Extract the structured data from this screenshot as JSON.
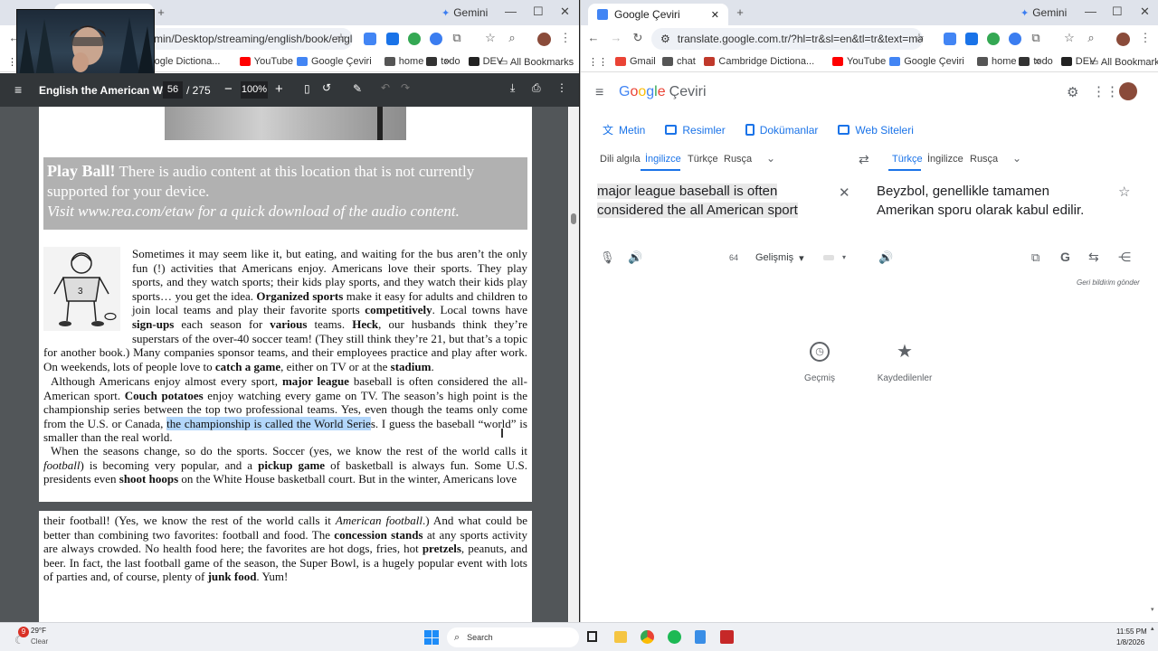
{
  "left_window": {
    "tab_title": "English the American Way",
    "gemini_label": "Gemini",
    "url": "min/Desktop/streaming/english/book/engli...",
    "bookmarks": [
      {
        "label": "Google Dictiona...",
        "color": "#4285f4"
      },
      {
        "label": "YouTube",
        "color": "#ff0000"
      },
      {
        "label": "Google Çeviri",
        "color": "#4285f4"
      },
      {
        "label": "home",
        "color": "#555555"
      },
      {
        "label": "todo",
        "color": "#333333"
      },
      {
        "label": "DEV",
        "color": "#222222"
      }
    ],
    "all_bookmarks": "All Bookmarks",
    "pdf": {
      "title": "English the American Way",
      "page_current": "56",
      "page_total": "/ 275",
      "zoom": "100%",
      "audio_bold": "Play Ball!",
      "audio_text": " There is audio content at this location that is not currently supported for your device.",
      "audio_link": "Visit www.rea.com/etaw for a quick download of the audio content.",
      "para1": [
        {
          "t": "Sometimes it may seem like it, but eating, and waiting for the bus aren’t the only fun (!) activities that Americans enjoy. Americans love their sports. They play sports, and they watch sports; their kids play sports, and they watch their kids play sports… you get the idea. "
        },
        {
          "t": "Organized sports",
          "b": true
        },
        {
          "t": " make it easy for adults and children to join local teams and play their favorite sports "
        },
        {
          "t": "competitively",
          "b": true
        },
        {
          "t": ". Local towns have "
        },
        {
          "t": "sign-ups",
          "b": true
        },
        {
          "t": " each season for "
        },
        {
          "t": "various",
          "b": true
        },
        {
          "t": " teams. "
        },
        {
          "t": "Heck",
          "b": true
        },
        {
          "t": ", our husbands think they’re superstars of the over-40 soccer team! (They still think they’re 21, but that’s a topic for another book.) Many companies sponsor teams, and their employees practice and play after work. On weekends, lots of people love to "
        },
        {
          "t": "catch a game",
          "b": true
        },
        {
          "t": ", either on TV or at the "
        },
        {
          "t": "stadium",
          "b": true
        },
        {
          "t": "."
        }
      ],
      "para2": [
        {
          "t": "Although Americans enjoy almost every sport, "
        },
        {
          "t": "major league",
          "b": true
        },
        {
          "t": " baseball is often considered the all-American sport. "
        },
        {
          "t": "Couch potatoes",
          "b": true
        },
        {
          "t": " enjoy watching every game on TV. The season’s high point is the championship series between the top two professional teams. Yes, even though the teams only come from the U.S. or Canada, "
        },
        {
          "t": "the championship is called the World Serie",
          "h": true
        },
        {
          "t": "s. I guess the baseball “world” is smaller than the real world."
        }
      ],
      "para3": [
        {
          "t": "When the seasons change, so do the sports. Soccer (yes, we know the rest of the world calls it "
        },
        {
          "t": "football",
          "i": true
        },
        {
          "t": ") is becoming very popular, and a "
        },
        {
          "t": "pickup game",
          "b": true
        },
        {
          "t": " of basketball is always fun. Some U.S. presidents even "
        },
        {
          "t": "shoot hoops",
          "b": true
        },
        {
          "t": " on the White House basketball court. But in the winter, Americans love"
        }
      ],
      "para4": [
        {
          "t": "their football! (Yes, we know the rest of the world calls it "
        },
        {
          "t": "American football",
          "i": true
        },
        {
          "t": ".) And what could be better than combining two favorites: football and food. The "
        },
        {
          "t": "concession stands",
          "b": true
        },
        {
          "t": " at any sports activity are always crowded. No health food here; the favorites are hot dogs, fries, hot "
        },
        {
          "t": "pretzels",
          "b": true
        },
        {
          "t": ", peanuts, and beer. In fact, the last football game of the season, the Super Bowl, is a hugely popular event with lots of parties and, of course, plenty of "
        },
        {
          "t": "junk food",
          "b": true
        },
        {
          "t": ". Yum!"
        }
      ]
    }
  },
  "right_window": {
    "tab_title": "Google Çeviri",
    "gemini_label": "Gemini",
    "url": "translate.google.com.tr/?hl=tr&sl=en&tl=tr&text=major%2...",
    "bookmarks": [
      {
        "label": "Gmail",
        "color": "#ea4335"
      },
      {
        "label": "chat",
        "color": "#555555"
      },
      {
        "label": "Cambridge Dictiona...",
        "color": "#c0392b"
      },
      {
        "label": "YouTube",
        "color": "#ff0000"
      },
      {
        "label": "Google Çeviri",
        "color": "#4285f4"
      },
      {
        "label": "home",
        "color": "#555555"
      },
      {
        "label": "todo",
        "color": "#333333"
      },
      {
        "label": "DEV",
        "color": "#222222"
      }
    ],
    "all_bookmarks": "All Bookmarks",
    "app_name": "Çeviri",
    "logo_letters": [
      {
        "c": "G",
        "color": "#4285f4"
      },
      {
        "c": "o",
        "color": "#ea4335"
      },
      {
        "c": "o",
        "color": "#fbbc05"
      },
      {
        "c": "g",
        "color": "#4285f4"
      },
      {
        "c": "l",
        "color": "#34a853"
      },
      {
        "c": "e",
        "color": "#ea4335"
      }
    ],
    "modes": [
      "Metin",
      "Resimler",
      "Dokümanlar",
      "Web Siteleri"
    ],
    "source_langs": [
      "Dili algıla",
      "İngilizce",
      "Türkçe",
      "Rusça"
    ],
    "target_langs": [
      "Türkçe",
      "İngilizce",
      "Rusça"
    ],
    "source_text": "major league baseball is often considered the all American sport",
    "translated_text": "Beyzbol, genellikle tamamen Amerikan sporu olarak kabul edilir.",
    "char_count": "64",
    "mode_select": "Gelişmiş",
    "feedback": "Geri bildirim gönder",
    "history_label": "Geçmiş",
    "saved_label": "Kaydedilenler"
  },
  "taskbar": {
    "weather_temp": "29°F",
    "weather_desc": "Clear",
    "weather_badge": "9",
    "search_placeholder": "Search",
    "time": "11:55 PM",
    "date": "1/8/2026"
  }
}
